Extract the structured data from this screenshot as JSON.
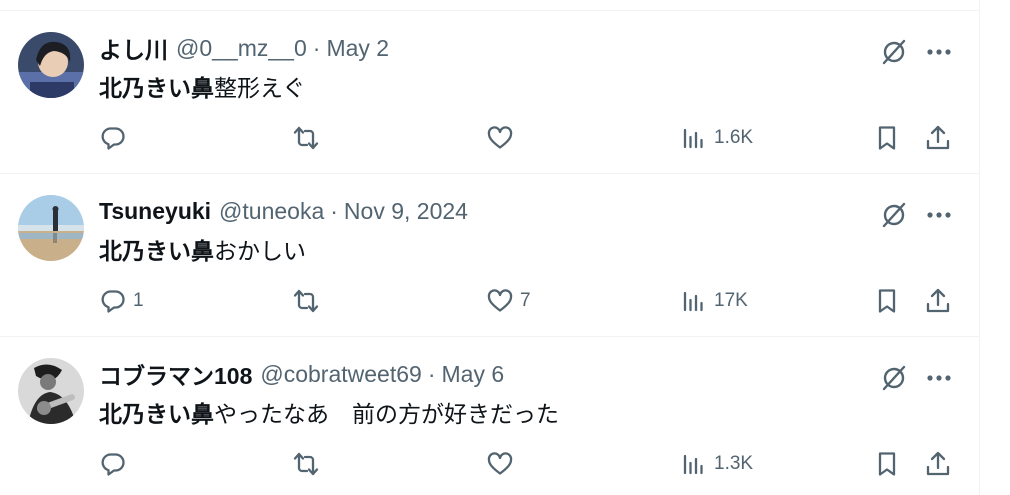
{
  "tweets": [
    {
      "author_name": "よし川",
      "handle": "@0__mz__0",
      "separator": "·",
      "date": "May 2",
      "text_bold": "北乃きい鼻",
      "text_rest": "整形えぐ",
      "replies": "",
      "reposts": "",
      "likes": "",
      "views": "1.6K"
    },
    {
      "author_name": "Tsuneyuki",
      "handle": "@tuneoka",
      "separator": "·",
      "date": "Nov 9, 2024",
      "text_bold": "北乃きい鼻",
      "text_rest": "おかしい",
      "replies": "1",
      "reposts": "",
      "likes": "7",
      "views": "17K"
    },
    {
      "author_name": "コブラマン108",
      "handle": "@cobratweet69",
      "separator": "·",
      "date": "May 6",
      "text_bold": "北乃きい鼻",
      "text_rest": "やったなあ　前の方が好きだった",
      "replies": "",
      "reposts": "",
      "likes": "",
      "views": "1.3K"
    }
  ],
  "icons": {
    "reply": "reply-icon",
    "repost": "repost-icon",
    "like": "like-icon",
    "views": "views-icon",
    "bookmark": "bookmark-icon",
    "share": "share-icon",
    "grok": "grok-icon",
    "more": "more-icon"
  },
  "colors": {
    "text": "#0f1419",
    "secondary": "#536471",
    "divider": "#eff3f4"
  }
}
